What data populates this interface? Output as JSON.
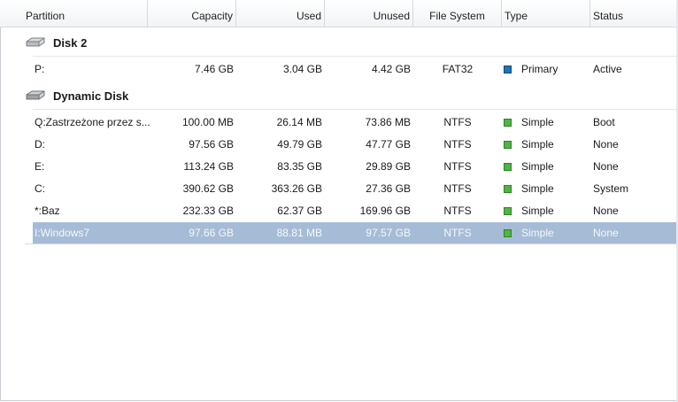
{
  "columns": {
    "partition": "Partition",
    "capacity": "Capacity",
    "used": "Used",
    "unused": "Unused",
    "file_system": "File System",
    "type": "Type",
    "status": "Status"
  },
  "disks": [
    {
      "name": "Disk 2",
      "icon": "hard-disk-icon"
    },
    {
      "name": "Dynamic Disk",
      "icon": "dynamic-disk-icon"
    }
  ],
  "rows": [
    {
      "partition": "P:",
      "capacity": "7.46 GB",
      "used": "3.04 GB",
      "unused": "4.42 GB",
      "fs": "FAT32",
      "type": "Primary",
      "type_color": "#1f73b7",
      "status": "Active"
    },
    {
      "partition": "Q:Zastrzeżone przez s...",
      "capacity": "100.00 MB",
      "used": "26.14 MB",
      "unused": "73.86 MB",
      "fs": "NTFS",
      "type": "Simple",
      "type_color": "#4fb544",
      "status": "Boot"
    },
    {
      "partition": "D:",
      "capacity": "97.56 GB",
      "used": "49.79 GB",
      "unused": "47.77 GB",
      "fs": "NTFS",
      "type": "Simple",
      "type_color": "#4fb544",
      "status": "None"
    },
    {
      "partition": "E:",
      "capacity": "113.24 GB",
      "used": "83.35 GB",
      "unused": "29.89 GB",
      "fs": "NTFS",
      "type": "Simple",
      "type_color": "#4fb544",
      "status": "None"
    },
    {
      "partition": "C:",
      "capacity": "390.62 GB",
      "used": "363.26 GB",
      "unused": "27.36 GB",
      "fs": "NTFS",
      "type": "Simple",
      "type_color": "#4fb544",
      "status": "System"
    },
    {
      "partition": "*:Baz",
      "capacity": "232.33 GB",
      "used": "62.37 GB",
      "unused": "169.96 GB",
      "fs": "NTFS",
      "type": "Simple",
      "type_color": "#4fb544",
      "status": "None"
    },
    {
      "partition": "I:Windows7",
      "capacity": "97.66 GB",
      "used": "88.81 MB",
      "unused": "97.57 GB",
      "fs": "NTFS",
      "type": "Simple",
      "type_color": "#4fb544",
      "status": "None",
      "selected": true
    }
  ]
}
